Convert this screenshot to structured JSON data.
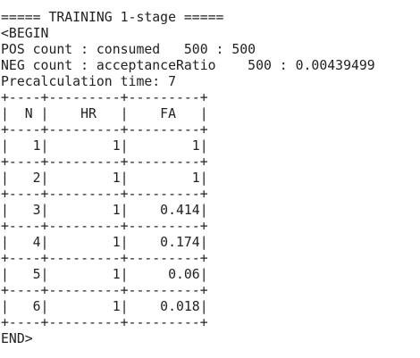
{
  "console": {
    "lines": [
      "===== TRAINING 1-stage =====",
      "<BEGIN",
      "POS count : consumed   500 : 500",
      "NEG count : acceptanceRatio    500 : 0.00439499",
      "Precalculation time: 7",
      "+----+---------+---------+",
      "|  N |    HR   |    FA   |",
      "+----+---------+---------+",
      "|   1|        1|        1|",
      "+----+---------+---------+",
      "|   2|        1|        1|",
      "+----+---------+---------+",
      "|   3|        1|    0.414|",
      "+----+---------+---------+",
      "|   4|        1|    0.174|",
      "+----+---------+---------+",
      "|   5|        1|     0.06|",
      "+----+---------+---------+",
      "|   6|        1|    0.018|",
      "+----+---------+---------+",
      "END>"
    ]
  }
}
